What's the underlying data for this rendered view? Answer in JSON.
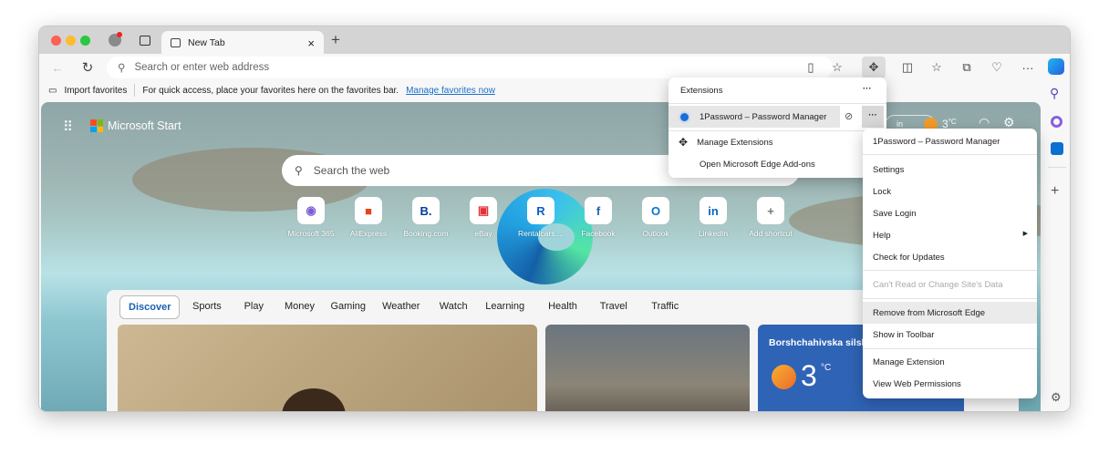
{
  "tab": {
    "title": "New Tab"
  },
  "address": {
    "placeholder": "Search or enter web address"
  },
  "favorites_bar": {
    "import": "Import favorites",
    "hint": "For quick access, place your favorites here on the favorites bar.",
    "manage_link": "Manage favorites now"
  },
  "start": {
    "brand": "Microsoft Start",
    "search_placeholder": "Search the web",
    "weather_temp": "3",
    "weather_unit": "°C"
  },
  "shortcuts": [
    {
      "label": "Microsoft 365",
      "glyph": "◉",
      "color": "#7a5cd6"
    },
    {
      "label": "AliExpress",
      "glyph": "■",
      "color": "#e8421c"
    },
    {
      "label": "Booking.com",
      "glyph": "B.",
      "color": "#003b95"
    },
    {
      "label": "eBay",
      "glyph": "▣",
      "color": "#e53238"
    },
    {
      "label": "Rentalcars....",
      "glyph": "R",
      "color": "#0a5ec4"
    },
    {
      "label": "Facebook",
      "glyph": "f",
      "color": "#1d5fb8"
    },
    {
      "label": "Outlook",
      "glyph": "O",
      "color": "#0a74d0"
    },
    {
      "label": "LinkedIn",
      "glyph": "in",
      "color": "#0a66c2"
    },
    {
      "label": "Add shortcut",
      "glyph": "+",
      "color": "#777"
    }
  ],
  "feed_tabs": [
    "Discover",
    "Sports",
    "Play",
    "Money",
    "Gaming",
    "Weather",
    "Watch",
    "Learning",
    "Health",
    "Travel",
    "Traffic"
  ],
  "weather_card": {
    "location": "Borshchahivska silsk",
    "temp": "3",
    "unit": "°C"
  },
  "extensions_popup": {
    "title": "Extensions",
    "more": "···",
    "item": "1Password – Password Manager",
    "manage": "Manage Extensions",
    "addons": "Open Microsoft Edge Add-ons"
  },
  "context_menu": {
    "header": "1Password – Password Manager",
    "items": [
      "Settings",
      "Lock",
      "Save Login",
      "Help",
      "Check for Updates"
    ],
    "disabled": "Can't Read or Change Site's Data",
    "remove": "Remove from Microsoft Edge",
    "show": "Show in Toolbar",
    "manage": "Manage Extension",
    "permissions": "View Web Permissions"
  }
}
